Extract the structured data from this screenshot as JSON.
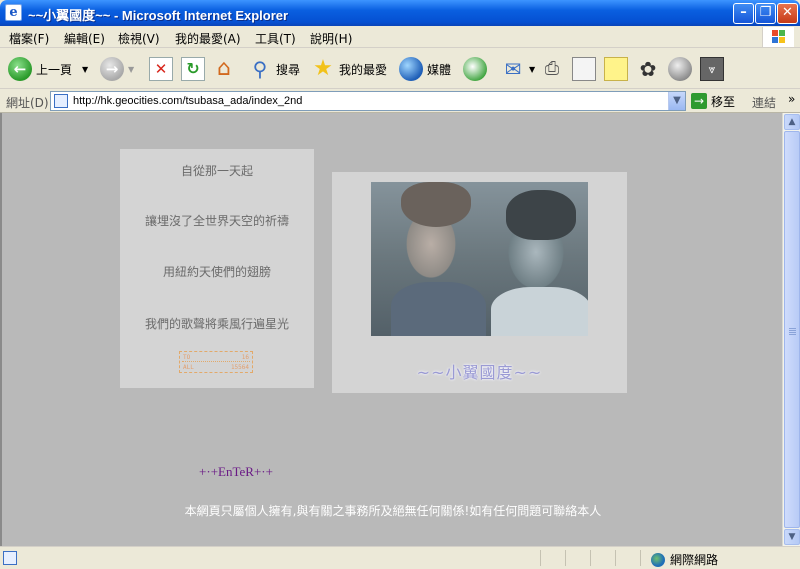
{
  "window": {
    "title": "~~小翼國度~~ - Microsoft Internet Explorer",
    "minimize_glyph": "–",
    "restore_glyph": "❐",
    "close_glyph": "✕"
  },
  "menu": {
    "items": [
      "檔案(F)",
      "編輯(E)",
      "檢視(V)",
      "我的最愛(A)",
      "工具(T)",
      "說明(H)"
    ]
  },
  "toolbar": {
    "back_label": "上一頁",
    "search_label": "搜尋",
    "favorites_label": "我的最愛",
    "media_label": "媒體"
  },
  "address": {
    "label": "網址(D)",
    "url": "http://hk.geocities.com/tsubasa_ada/index_2nd",
    "go_label": "移至",
    "links_label": "連結",
    "more_glyph": "»"
  },
  "page": {
    "poem_lines": [
      "自從那一天起",
      "讓埋沒了全世界天空的祈禱",
      "用紐約天使們的翅膀",
      "我們的歌聲將乘風行遍星光"
    ],
    "counter": {
      "today_label": "TO",
      "today_value": "16",
      "all_label": "ALL",
      "all_value": "15564"
    },
    "photo_caption": "~~小翼國度~~",
    "enter_link": "+·+EnTeR+·+",
    "footer_note": "本網頁只屬個人擁有,與有關之事務所及絕無任何關係!如有任何問題可聯絡本人"
  },
  "status": {
    "zone_label": "網際網路"
  },
  "colors": {
    "page_background": "#b9b9b9",
    "box_background": "#d4d4d4",
    "enter_link": "#6a1a86",
    "caption": "#9a9ad4"
  }
}
